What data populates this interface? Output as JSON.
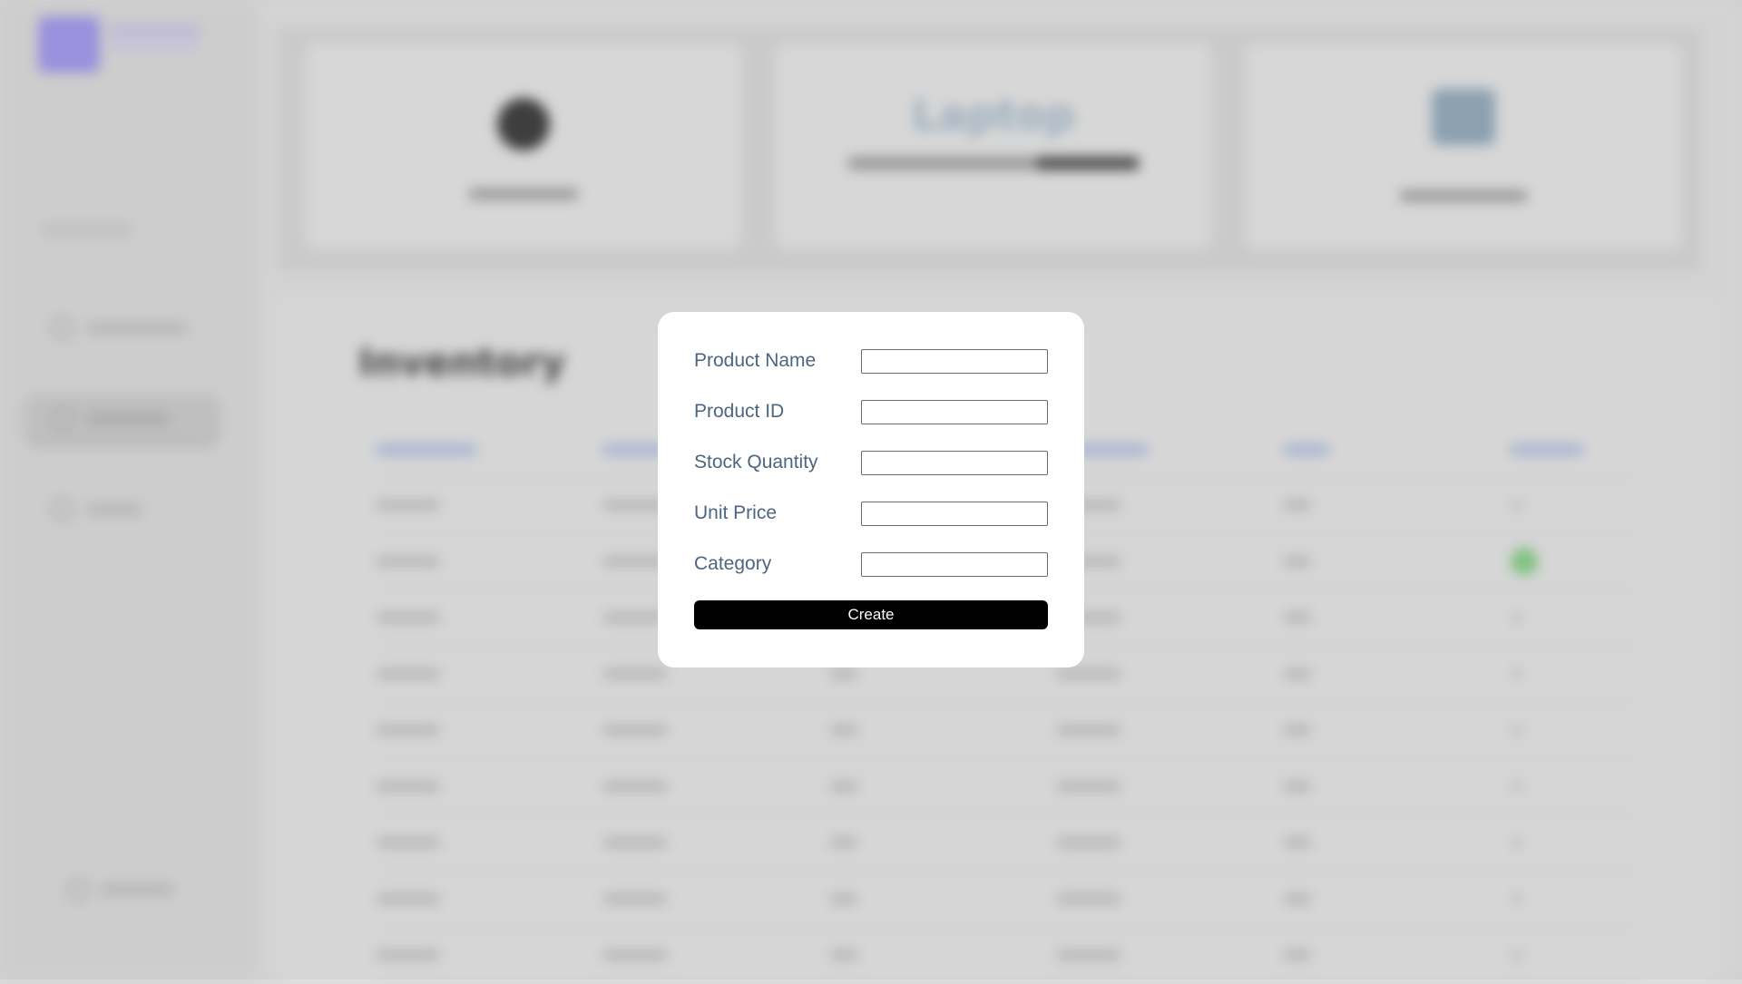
{
  "dialog": {
    "fields": [
      {
        "label": "Product Name",
        "value": "",
        "placeholder": ""
      },
      {
        "label": "Product ID",
        "value": "",
        "placeholder": ""
      },
      {
        "label": "Stock Quantity",
        "value": "",
        "placeholder": ""
      },
      {
        "label": "Unit Price",
        "value": "",
        "placeholder": ""
      },
      {
        "label": "Category",
        "value": "",
        "placeholder": ""
      }
    ],
    "create_label": "Create"
  },
  "background": {
    "stat_cards": [
      {
        "icon": "circle-icon"
      },
      {
        "big_text": "Laptop"
      },
      {
        "icon": "box-icon"
      }
    ],
    "inventory_title": "Inventory",
    "nav_icons": [
      "dashboard-icon",
      "products-icon",
      "orders-icon",
      "settings-icon"
    ],
    "colors": {
      "status_green": "#7fc97f",
      "header_blue": "#9fb3d8",
      "logo_purple": "#9d94e6"
    }
  }
}
